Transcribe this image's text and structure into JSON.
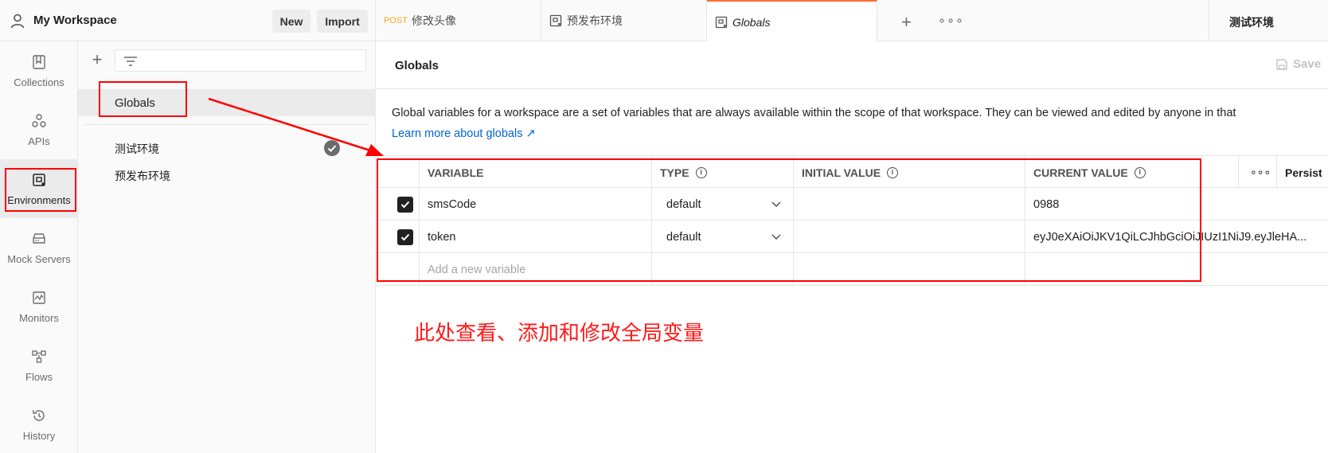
{
  "workspace": {
    "title": "My Workspace",
    "new_label": "New",
    "import_label": "Import"
  },
  "rail": [
    {
      "label": "Collections",
      "icon": "collections-icon"
    },
    {
      "label": "APIs",
      "icon": "apis-icon"
    },
    {
      "label": "Environments",
      "icon": "environments-icon",
      "active": true
    },
    {
      "label": "Mock Servers",
      "icon": "mock-servers-icon"
    },
    {
      "label": "Monitors",
      "icon": "monitors-icon"
    },
    {
      "label": "Flows",
      "icon": "flows-icon"
    },
    {
      "label": "History",
      "icon": "history-icon"
    }
  ],
  "env_list": {
    "globals_label": "Globals",
    "environments": [
      {
        "name": "测试环境",
        "active": true
      },
      {
        "name": "预发布环境",
        "active": false
      }
    ]
  },
  "tabs": [
    {
      "method": "POST",
      "label": "修改头像"
    },
    {
      "label": "预发布环境",
      "icon": "environment-icon"
    },
    {
      "label": "Globals",
      "icon": "environment-icon",
      "active": true
    }
  ],
  "environment_selector": {
    "value": "测试环境"
  },
  "main": {
    "title": "Globals",
    "save_label": "Save",
    "description": "Global variables for a workspace are a set of variables that are always available within the scope of that workspace. They can be viewed and edited by anyone in that",
    "learn_more": "Learn more about globals ↗"
  },
  "table": {
    "headers": {
      "variable": "VARIABLE",
      "type": "TYPE",
      "initial": "INITIAL VALUE",
      "current": "CURRENT VALUE",
      "persist": "Persist"
    },
    "rows": [
      {
        "checked": true,
        "variable": "smsCode",
        "type": "default",
        "initial": "",
        "current": "0988"
      },
      {
        "checked": true,
        "variable": "token",
        "type": "default",
        "initial": "",
        "current": "eyJ0eXAiOiJKV1QiLCJhbGciOiJIUzI1NiJ9.eyJleHA..."
      }
    ],
    "add_placeholder": "Add a new variable"
  },
  "annotation": {
    "text": "此处查看、添加和修改全局变量",
    "color": "#ff0000"
  }
}
